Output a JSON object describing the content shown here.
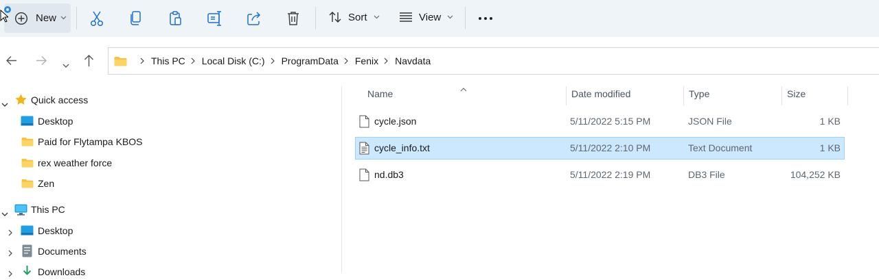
{
  "toolbar": {
    "new_label": "New",
    "sort_label": "Sort",
    "view_label": "View",
    "icons": [
      "new-icon",
      "cut-icon",
      "copy-icon",
      "paste-icon",
      "rename-icon",
      "share-icon",
      "delete-icon",
      "sort-icon",
      "view-icon",
      "more-icon"
    ]
  },
  "address": {
    "crumbs": [
      "This PC",
      "Local Disk (C:)",
      "ProgramData",
      "Fenix",
      "Navdata"
    ]
  },
  "nav": {
    "quick_access": {
      "label": "Quick access",
      "items": [
        {
          "label": "Desktop",
          "icon": "desktop-icon"
        },
        {
          "label": "Paid for Flytampa KBOS",
          "icon": "folder-icon"
        },
        {
          "label": "rex weather force",
          "icon": "folder-icon"
        },
        {
          "label": "Zen",
          "icon": "folder-icon"
        }
      ]
    },
    "this_pc": {
      "label": "This PC",
      "items": [
        {
          "label": "Desktop",
          "icon": "desktop-icon"
        },
        {
          "label": "Documents",
          "icon": "documents-icon"
        },
        {
          "label": "Downloads",
          "icon": "downloads-icon"
        }
      ]
    }
  },
  "file_list": {
    "columns": [
      "Name",
      "Date modified",
      "Type",
      "Size"
    ],
    "files": [
      {
        "name": "cycle.json",
        "date": "5/11/2022 5:15 PM",
        "type": "JSON File",
        "size": "1 KB",
        "selected": false
      },
      {
        "name": "cycle_info.txt",
        "date": "5/11/2022 2:10 PM",
        "type": "Text Document",
        "size": "1 KB",
        "selected": true
      },
      {
        "name": "nd.db3",
        "date": "5/11/2022 2:19 PM",
        "type": "DB3 File",
        "size": "104,252 KB",
        "selected": false
      }
    ]
  },
  "colors": {
    "toolbar_bg": "#eff4f9",
    "selection_bg": "#cce8ff",
    "selection_border": "#99d1ff",
    "folder_yellow": "#f7c244",
    "accent_blue": "#2f8ad6"
  }
}
